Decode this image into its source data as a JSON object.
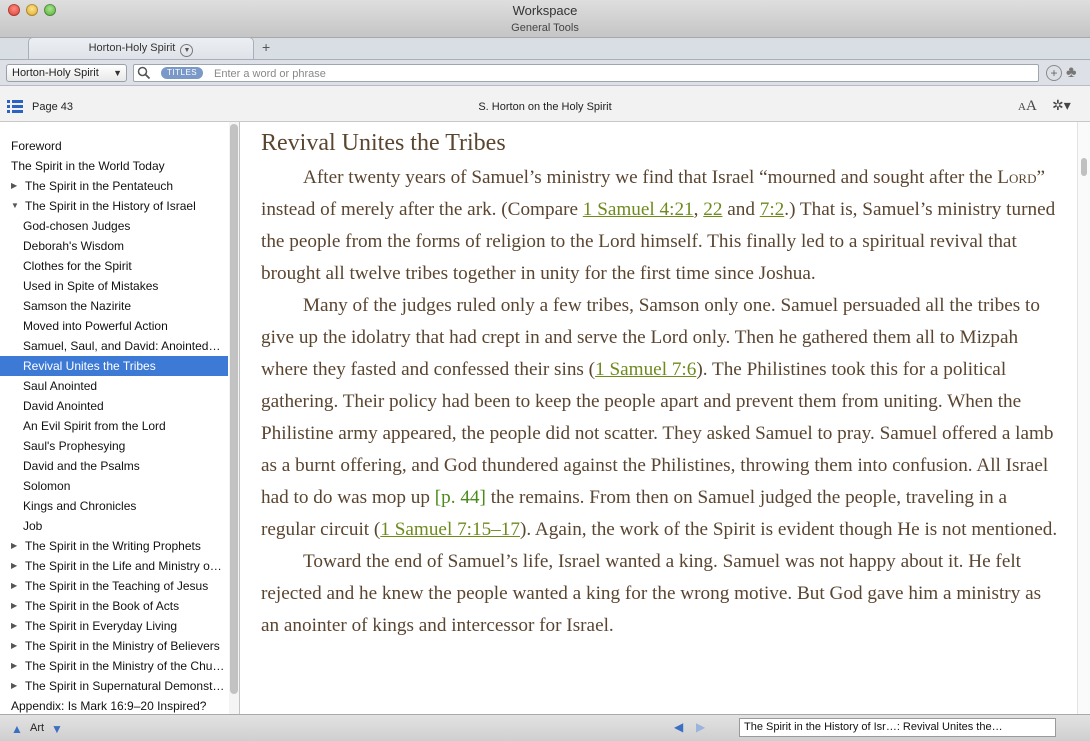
{
  "window": {
    "title": "Workspace",
    "subtitle": "General Tools"
  },
  "tabs": {
    "active_label": "Horton-Holy Spirit",
    "add_label": "+"
  },
  "search": {
    "resource": "Horton-Holy Spirit",
    "scope_badge": "TITLES",
    "placeholder": "Enter a word or phrase"
  },
  "panel": {
    "page": "Page 43",
    "book_title": "S. Horton on the Holy Spirit",
    "font_small": "A",
    "font_big": "A"
  },
  "toc": {
    "items": [
      {
        "label": "Foreword",
        "level": 0,
        "toggle": "none"
      },
      {
        "label": "The Spirit in the World Today",
        "level": 0,
        "toggle": "none"
      },
      {
        "label": "The Spirit in the Pentateuch",
        "level": 0,
        "toggle": "collapsed"
      },
      {
        "label": "The Spirit in the History of Israel",
        "level": 0,
        "toggle": "expanded"
      },
      {
        "label": "God-chosen Judges",
        "level": 1,
        "toggle": "none"
      },
      {
        "label": "Deborah's Wisdom",
        "level": 1,
        "toggle": "none"
      },
      {
        "label": "Clothes for the Spirit",
        "level": 1,
        "toggle": "none"
      },
      {
        "label": "Used in Spite of Mistakes",
        "level": 1,
        "toggle": "none"
      },
      {
        "label": "Samson the Nazirite",
        "level": 1,
        "toggle": "none"
      },
      {
        "label": "Moved into Powerful Action",
        "level": 1,
        "toggle": "none"
      },
      {
        "label": "Samuel, Saul, and David: Anointed…",
        "level": 1,
        "toggle": "none"
      },
      {
        "label": "Revival Unites the Tribes",
        "level": 1,
        "toggle": "none",
        "selected": true
      },
      {
        "label": "Saul Anointed",
        "level": 1,
        "toggle": "none"
      },
      {
        "label": "David Anointed",
        "level": 1,
        "toggle": "none"
      },
      {
        "label": "An Evil Spirit from the Lord",
        "level": 1,
        "toggle": "none"
      },
      {
        "label": "Saul's Prophesying",
        "level": 1,
        "toggle": "none"
      },
      {
        "label": "David and the Psalms",
        "level": 1,
        "toggle": "none"
      },
      {
        "label": "Solomon",
        "level": 1,
        "toggle": "none"
      },
      {
        "label": "Kings and Chronicles",
        "level": 1,
        "toggle": "none"
      },
      {
        "label": "Job",
        "level": 1,
        "toggle": "none"
      },
      {
        "label": "The Spirit in the Writing Prophets",
        "level": 0,
        "toggle": "collapsed"
      },
      {
        "label": "The Spirit in the Life and Ministry o…",
        "level": 0,
        "toggle": "collapsed"
      },
      {
        "label": "The Spirit in the Teaching of Jesus",
        "level": 0,
        "toggle": "collapsed"
      },
      {
        "label": "The Spirit in the Book of Acts",
        "level": 0,
        "toggle": "collapsed"
      },
      {
        "label": "The Spirit in Everyday Living",
        "level": 0,
        "toggle": "collapsed"
      },
      {
        "label": "The Spirit in the Ministry of Believers",
        "level": 0,
        "toggle": "collapsed"
      },
      {
        "label": "The Spirit in the Ministry of the Chu…",
        "level": 0,
        "toggle": "collapsed"
      },
      {
        "label": "The Spirit in Supernatural Demonst…",
        "level": 0,
        "toggle": "collapsed"
      },
      {
        "label": "Appendix: Is Mark 16:9–20 Inspired?",
        "level": 0,
        "toggle": "none"
      }
    ]
  },
  "article": {
    "heading": "Revival Unites the Tribes",
    "p1": {
      "a": "After twenty years of Samuel’s ministry we find that Israel “mourned and sought after the ",
      "lord": "Lord",
      "b": "” instead of merely after the ark. (Compare ",
      "ref1": "1 Samuel 4:21",
      "c": ", ",
      "ref2": "22",
      "d": " and ",
      "ref3": "7:2",
      "e": ".) That is, Samuel’s ministry turned the people from the forms of religion to the Lord himself. This finally led to a spiritual revival that brought all twelve tribes together in unity for the first time since Joshua."
    },
    "p2": {
      "a": "Many of the judges ruled only a few tribes, Samson only one. Samuel persuaded all the tribes to give up the idolatry that had crept in and serve the Lord only. Then he gathered them all to Mizpah where they fasted and confessed their sins (",
      "ref1": "1 Samuel 7:6",
      "b": "). The Philistines took this for a political gathering. Their policy had been to keep the people apart and prevent them from uniting. When the Philistine army appeared, the people did not scatter. They asked Samuel to pray. Samuel offered a lamb as a burnt offering, and God thundered against the Philistines, throwing them into confusion. All Israel had to do was mop up ",
      "pageref": "[p. 44]",
      "c": " the remains. From then on Samuel judged the people, traveling in a regular circuit (",
      "ref2": "1 Samuel 7:15–17",
      "d": "). Again, the work of the Spirit is evident though He is not mentioned."
    },
    "p3": "Toward the end of Samuel’s life, Israel wanted a king. Samuel was not happy about it. He felt rejected and he knew the people wanted a king for the wrong motive. But God gave him a ministry as an anointer of kings and intercessor for Israel."
  },
  "bottom": {
    "label": "Art",
    "location": "The Spirit in the History of Isr…: Revival Unites the…"
  }
}
